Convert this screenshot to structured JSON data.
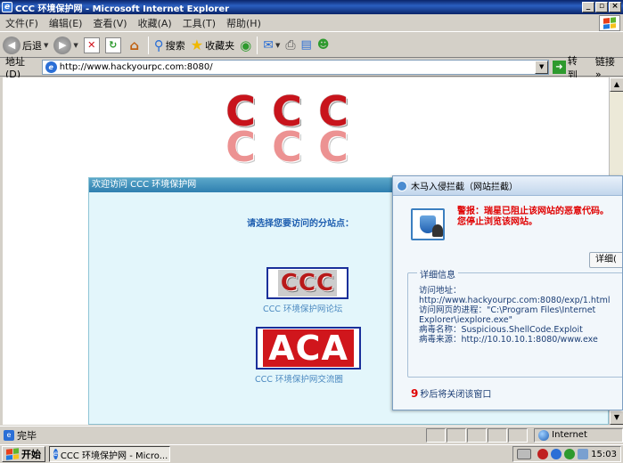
{
  "window": {
    "title": "CCC 环境保护网 - Microsoft Internet Explorer",
    "buttons": {
      "minimize": "_",
      "maximize": "▫",
      "close": "×"
    }
  },
  "menu": [
    "文件(F)",
    "编辑(E)",
    "查看(V)",
    "收藏(A)",
    "工具(T)",
    "帮助(H)"
  ],
  "toolbar": {
    "back_label": "后退",
    "search_label": "搜索",
    "favorites_label": "收藏夹"
  },
  "address": {
    "label": "地址(D)",
    "url": "http://www.hackyourpc.com:8080/",
    "go_label": "转到",
    "links_label": "链接",
    "links_more": "»"
  },
  "page": {
    "logo_letters": [
      "C",
      "C",
      "C"
    ],
    "panel_title": "欢迎访问  CCC 环境保护网",
    "choose_prompt": "请选择您要访问的分站点：",
    "site1_logo": "CCC",
    "site1_caption": "CCC 环境保护网论坛",
    "site2_logo": "ACA",
    "site2_caption": "CCC 环境保护网交流圈"
  },
  "popup": {
    "title": "木马入侵拦截（网站拦截）",
    "warning_line1": "警报：瑞星已阻止该网站的恶意代码。",
    "warning_line2": "您停止浏览该网站。",
    "details_button": "详细(",
    "details_legend": "详细信息",
    "details": [
      "访问地址：",
      "http://www.hackyourpc.com:8080/exp/1.html",
      "访问网页的进程：\"C:\\Program Files\\Internet",
      "Explorer\\iexplore.exe\"",
      "病毒名称：Suspicious.ShellCode.Exploit",
      "病毒来源：http://10.10.10.1:8080/www.exe"
    ],
    "countdown_number": "9",
    "countdown_text": "秒后将关闭该窗口"
  },
  "status": {
    "text": "完毕",
    "zone": "Internet"
  },
  "taskbar": {
    "start": "开始",
    "task": "CCC 环境保护网 - Micro...",
    "clock": "15:03"
  }
}
